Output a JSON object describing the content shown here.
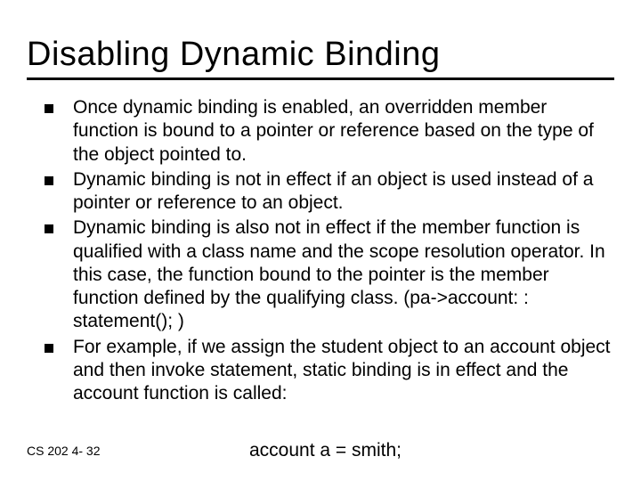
{
  "slide": {
    "title": "Disabling Dynamic Binding",
    "bullets": [
      "Once dynamic binding is enabled, an overridden member function is bound to a pointer or reference based on the type of the object pointed to.",
      "Dynamic binding is not in effect if an object is used instead of a pointer or reference to an object.",
      "Dynamic binding is also not in effect if the member function is qualified with a class name and the scope resolution operator. In this case, the function bound to the pointer is the member function defined by the qualifying class. (pa->account: : statement(); )",
      "For example, if we assign the student object to an account object and then invoke statement, static binding is in effect and the account function is called:"
    ],
    "codeLine": "account a = smith;",
    "footer": "CS 202   4- 32"
  }
}
